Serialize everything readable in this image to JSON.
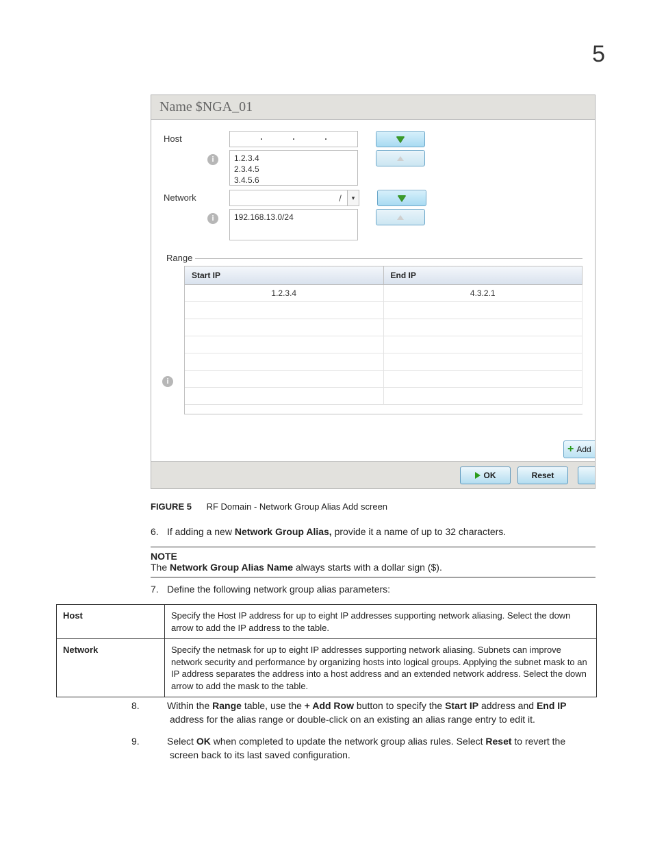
{
  "page_number": "5",
  "screenshot": {
    "title": "Name  $NGA_01",
    "host_label": "Host",
    "host_list": "1.2.3.4\n2.3.4.5\n3.4.5.6",
    "network_label": "Network",
    "network_list": "192.168.13.0/24",
    "range_label": "Range",
    "range_headers": {
      "start": "Start IP",
      "end": "End IP"
    },
    "range_rows": [
      {
        "start": "1.2.3.4",
        "end": "4.3.2.1"
      }
    ],
    "add_row_label": "Add",
    "ok_label": "OK",
    "reset_label": "Reset"
  },
  "caption_label": "FIGURE 5",
  "caption_text": "RF Domain - Network Group Alias Add screen",
  "step6": {
    "num": "6.",
    "text_a": "If adding a new ",
    "bold": "Network Group Alias,",
    "text_b": " provide it a name of up to 32 characters."
  },
  "note": {
    "label": "NOTE",
    "text_a": "The ",
    "bold": "Network Group Alias Name",
    "text_b": " always starts with a dollar sign ($)."
  },
  "step7": {
    "num": "7.",
    "text": "Define the following network group alias parameters:"
  },
  "params": {
    "host": {
      "label": "Host",
      "desc": "Specify the Host IP address for up to eight IP addresses supporting network aliasing. Select the down arrow to add the IP address to the table."
    },
    "network": {
      "label": "Network",
      "desc": "Specify the netmask for up to eight IP addresses supporting network aliasing. Subnets can improve network security and performance by organizing hosts into logical groups. Applying the subnet mask to an IP address separates the address into a host address and an extended network address. Select the down arrow to add the mask to the table."
    }
  },
  "step8": {
    "num": "8.",
    "text_a": "Within the ",
    "b1": "Range",
    "text_b": " table, use the ",
    "b2": "+ Add Row",
    "text_c": " button to specify the ",
    "b3": "Start IP",
    "text_d": " address and ",
    "b4": "End IP",
    "text_e": " address for the alias range or double-click on an existing an alias range entry to edit it."
  },
  "step9": {
    "num": "9.",
    "text_a": "Select ",
    "b1": "OK",
    "text_b": " when completed to update the network group alias rules. Select ",
    "b2": "Reset",
    "text_c": " to revert the screen back to its last saved configuration."
  }
}
